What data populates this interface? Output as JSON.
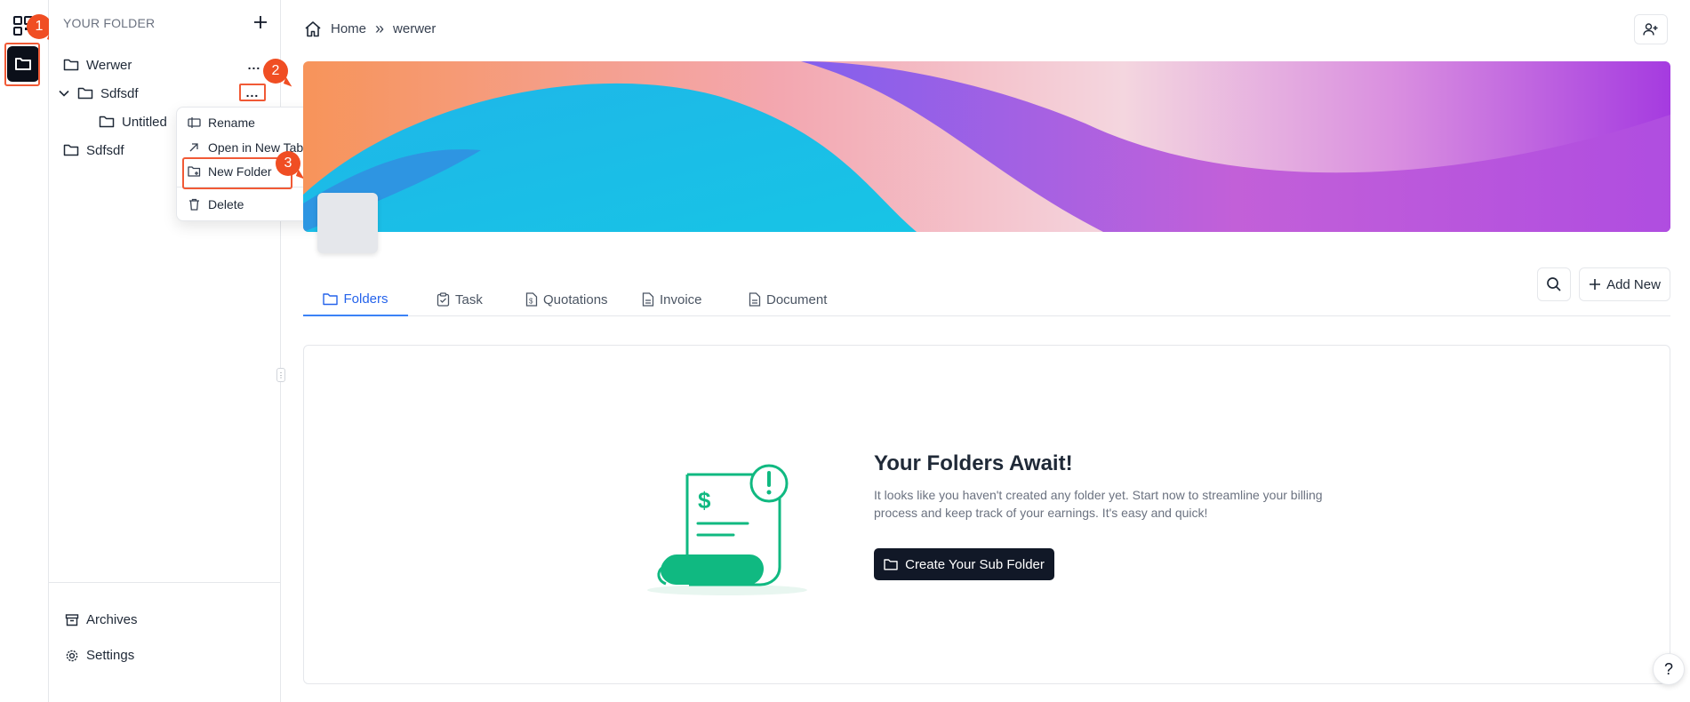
{
  "sidebar": {
    "title": "YOUR FOLDER",
    "tree": [
      {
        "label": "Werwer"
      },
      {
        "label": "Sdfsdf"
      },
      {
        "label": "Untitled"
      },
      {
        "label": "Sdfsdf"
      }
    ],
    "more_label": "...",
    "archives_label": "Archives",
    "settings_label": "Settings"
  },
  "context_menu": {
    "items": [
      {
        "label": "Rename",
        "icon": "rename-icon"
      },
      {
        "label": "Open in New Tab",
        "icon": "arrow-up-right-icon"
      },
      {
        "label": "New Folder",
        "icon": "folder-plus-icon"
      },
      {
        "label": "Delete",
        "icon": "trash-icon"
      }
    ]
  },
  "steps": [
    "1",
    "2",
    "3"
  ],
  "breadcrumb": {
    "home": "Home",
    "separator": "»",
    "current": "werwer"
  },
  "tabs": [
    {
      "label": "Folders",
      "active": true
    },
    {
      "label": "Task",
      "active": false
    },
    {
      "label": "Quotations",
      "active": false
    },
    {
      "label": "Invoice",
      "active": false
    },
    {
      "label": "Document",
      "active": false
    }
  ],
  "toolbar": {
    "add_new_label": "Add New"
  },
  "empty_state": {
    "title": "Your Folders Await!",
    "description": "It looks like you haven't created any folder yet. Start now to streamline your billing process and keep track of your earnings. It's easy and quick!",
    "cta_label": "Create Your Sub Folder"
  },
  "help_label": "?",
  "colors": {
    "accent": "#2563eb",
    "highlight": "#f15a36",
    "dark": "#111827",
    "illustration": "#10b981"
  }
}
